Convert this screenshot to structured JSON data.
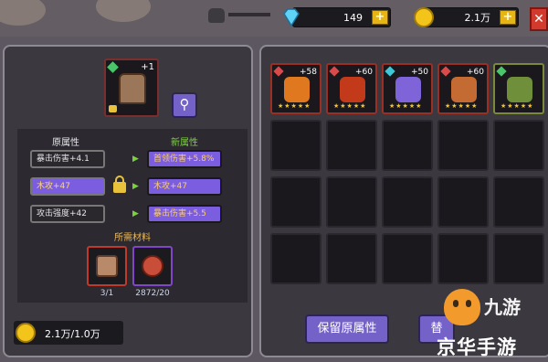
{
  "topbar": {
    "gems": "149",
    "gold": "2.1万",
    "plus_label": "+",
    "close_label": "✕",
    "icons": [
      "skull-icon",
      "diamond-icon",
      "coin-icon",
      "close-icon"
    ]
  },
  "hero": {
    "level": "+1",
    "zoom_icon": "magnifier-icon"
  },
  "attributes": {
    "old_header": "原属性",
    "new_header": "新属性",
    "old": [
      "暴击伤害+4.1",
      "木攻+47",
      "攻击强度+42"
    ],
    "new": [
      "首领伤害+5.8%",
      "木攻+47",
      "暴击伤害+5.5"
    ]
  },
  "materials": {
    "label": "所需材料",
    "counts": [
      "3/1",
      "2872/20"
    ]
  },
  "gold_cost": "2.1万/1.0万",
  "inventory": {
    "items": [
      {
        "level": "+58",
        "tag": "red",
        "color": "#e0781f"
      },
      {
        "level": "+60",
        "tag": "red",
        "color": "#c23a1a"
      },
      {
        "level": "+50",
        "tag": "blue",
        "color": "#7f63d8"
      },
      {
        "level": "+60",
        "tag": "red",
        "color": "#c46a33"
      },
      {
        "level": "",
        "tag": "green",
        "color": "#6f8f3a"
      }
    ],
    "stars": "★★★★★"
  },
  "buttons": {
    "keep": "保留原属性",
    "replace": "替"
  },
  "watermark": {
    "logo_text": "九游",
    "site": "京华手游"
  }
}
